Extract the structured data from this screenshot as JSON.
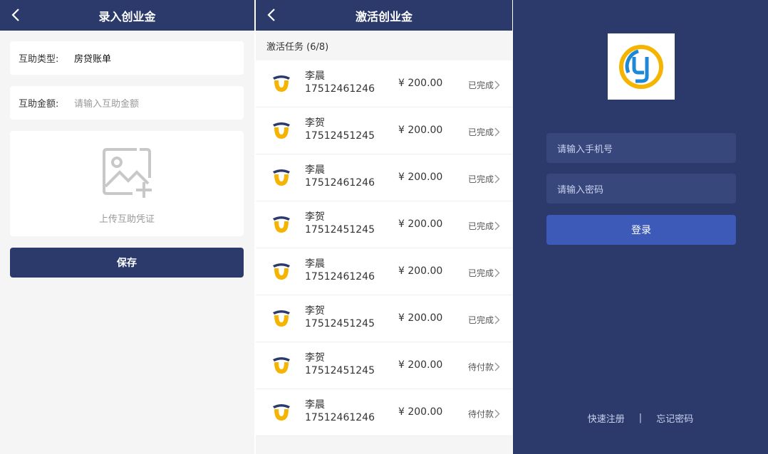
{
  "screen1": {
    "title": "录入创业金",
    "type_label": "互助类型:",
    "type_value": "房贷账单",
    "amount_label": "互助金额:",
    "amount_placeholder": "请输入互助金额",
    "upload_text": "上传互助凭证",
    "save_label": "保存"
  },
  "screen2": {
    "title": "激活创业金",
    "task_header": "激活任务 (6/8)",
    "tasks": [
      {
        "name": "李晨",
        "phone": "17512461246",
        "amount": "¥ 200.00",
        "status": "已完成"
      },
      {
        "name": "李贺",
        "phone": "17512451245",
        "amount": "¥ 200.00",
        "status": "已完成"
      },
      {
        "name": "李晨",
        "phone": "17512461246",
        "amount": "¥ 200.00",
        "status": "已完成"
      },
      {
        "name": "李贺",
        "phone": "17512451245",
        "amount": "¥ 200.00",
        "status": "已完成"
      },
      {
        "name": "李晨",
        "phone": "17512461246",
        "amount": "¥ 200.00",
        "status": "已完成"
      },
      {
        "name": "李贺",
        "phone": "17512451245",
        "amount": "¥ 200.00",
        "status": "已完成"
      },
      {
        "name": "李贺",
        "phone": "17512451245",
        "amount": "¥ 200.00",
        "status": "待付款"
      },
      {
        "name": "李晨",
        "phone": "17512461246",
        "amount": "¥ 200.00",
        "status": "待付款"
      }
    ]
  },
  "screen3": {
    "phone_placeholder": "请输入手机号",
    "password_placeholder": "请输入密码",
    "login_label": "登录",
    "register_link": "快速注册",
    "separator": "|",
    "forgot_link": "忘记密码"
  },
  "colors": {
    "primary": "#2c3a6b",
    "accent": "#3e5ab9",
    "logo_yellow": "#f5b400",
    "logo_blue": "#1e88d8"
  }
}
